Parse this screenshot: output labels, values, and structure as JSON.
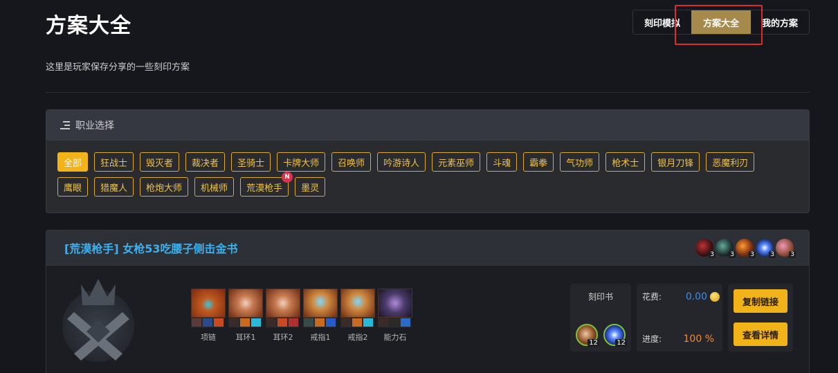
{
  "header": {
    "title": "方案大全",
    "subtitle": "这里是玩家保存分享的一些刻印方案"
  },
  "tabs": [
    {
      "label": "刻印模拟",
      "active": false
    },
    {
      "label": "方案大全",
      "active": true
    },
    {
      "label": "我的方案",
      "active": false
    }
  ],
  "job_panel": {
    "title": "职业选择",
    "jobs": [
      "全部",
      "狂战士",
      "毁灭者",
      "裁决者",
      "圣骑士",
      "卡牌大师",
      "召唤师",
      "吟游诗人",
      "元素巫师",
      "斗魂",
      "霸拳",
      "气功师",
      "枪术士",
      "银月刀锋",
      "恶魔利刃",
      "鹰眼",
      "猎魔人",
      "枪炮大师",
      "机械师",
      "荒漠枪手",
      "墨灵"
    ],
    "active_job": "全部",
    "new_badge": "N"
  },
  "plan": {
    "title": "[荒漠枪手] 女枪53吃腰子侧击金书",
    "engravings": [
      {
        "icon": "engraving-icon-1",
        "level": "3"
      },
      {
        "icon": "engraving-icon-2",
        "level": "3"
      },
      {
        "icon": "engraving-icon-3",
        "level": "3"
      },
      {
        "icon": "engraving-icon-4",
        "level": "3"
      },
      {
        "icon": "engraving-icon-5",
        "level": "3"
      }
    ],
    "gear": [
      {
        "label": "项链",
        "icon": "necklace-icon"
      },
      {
        "label": "耳环1",
        "icon": "earring-icon"
      },
      {
        "label": "耳环2",
        "icon": "earring-icon"
      },
      {
        "label": "戒指1",
        "icon": "ring-icon"
      },
      {
        "label": "戒指2",
        "icon": "ring-icon"
      },
      {
        "label": "能力石",
        "icon": "ability-stone-icon"
      }
    ],
    "book": {
      "title": "刻印书",
      "items": [
        {
          "icon": "book-engraving-icon-1",
          "level": "12"
        },
        {
          "icon": "book-engraving-icon-2",
          "level": "12"
        }
      ]
    },
    "cost_label": "花费:",
    "cost_value": "0.00",
    "progress_label": "进度:",
    "progress_value": "100 %",
    "copy_button": "复制链接",
    "detail_button": "查看详情"
  },
  "colors": {
    "accent_gold": "#f2b21a",
    "tab_active": "#a58a4b",
    "title_blue": "#3bb1f0",
    "progress_orange": "#f28a2e",
    "highlight_red": "#e12b2b"
  }
}
